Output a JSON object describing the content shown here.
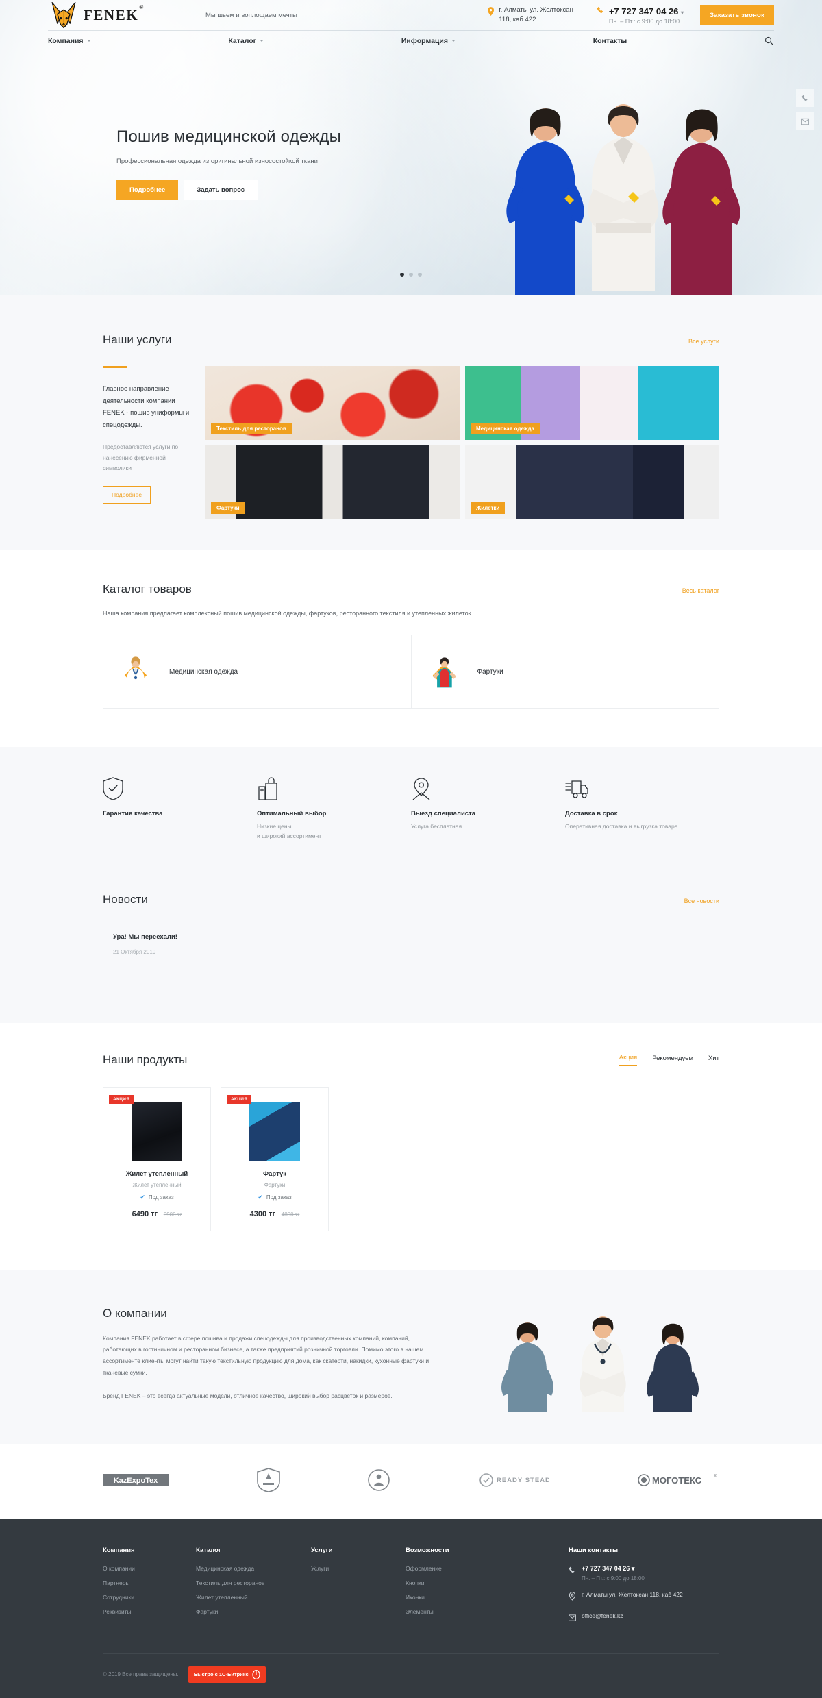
{
  "header": {
    "logo_text": "FENEK",
    "logo_reg": "®",
    "tagline": "Мы шьем и воплощаем мечты",
    "address_line1": "г. Алматы ул. Желтоксан",
    "address_line2": "118, каб 422",
    "phone": "+7 727 347 04 26",
    "phone_hours": "Пн. – Пт.: с 9:00 до 18:00",
    "order_button": "Заказать звонок",
    "nav": [
      {
        "label": "Компания",
        "has_caret": true
      },
      {
        "label": "Каталог",
        "has_caret": true
      },
      {
        "label": "Информация",
        "has_caret": true
      },
      {
        "label": "Контакты",
        "has_caret": false
      }
    ]
  },
  "hero": {
    "title": "Пошив медицинской одежды",
    "subtitle": "Профессиональная одежда из оригинальной износостойкой ткани",
    "btn_primary": "Подробнее",
    "btn_secondary": "Задать вопрос",
    "slides": 3,
    "active_slide": 1
  },
  "services": {
    "title": "Наши услуги",
    "all_link": "Все услуги",
    "lead": "Главное направление деятельности компании FENEK - пошив униформы и спецодежды.",
    "note": "Предоставляются услуги по нанесению фирменной символики",
    "button": "Подробнее",
    "cards": [
      {
        "label": "Текстиль для ресторанов",
        "art": "ph-rest"
      },
      {
        "label": "Медицинская одежда",
        "art": "ph-med"
      },
      {
        "label": "Фартуки",
        "art": "ph-apr"
      },
      {
        "label": "Жилетки",
        "art": "ph-vest"
      }
    ]
  },
  "catalog": {
    "title": "Каталог товаров",
    "all_link": "Весь каталог",
    "description": "Наша компания предлагает комплексный пошив медицинской одежды, фартуков, ресторанного текстиля и утепленных жилеток",
    "items": [
      {
        "name": "Медицинская одежда",
        "icon": "doctor-icon"
      },
      {
        "name": "Фартуки",
        "icon": "apron-woman-icon"
      }
    ]
  },
  "features": [
    {
      "icon": "shield-check-icon",
      "title": "Гарантия качества",
      "sub": ""
    },
    {
      "icon": "price-tag-bag-icon",
      "title": "Оптимальный выбор",
      "sub": "Низкие цены\nи широкий ассортимент"
    },
    {
      "icon": "map-pin-person-icon",
      "title": "Выезд специалиста",
      "sub": "Услуга бесплатная"
    },
    {
      "icon": "delivery-truck-icon",
      "title": "Доставка в срок",
      "sub": "Оперативная доставка и выгрузка товара"
    }
  ],
  "news": {
    "title": "Новости",
    "all_link": "Все новости",
    "items": [
      {
        "title": "Ура! Мы переехали!",
        "date": "21 Октября 2019"
      }
    ]
  },
  "products": {
    "title": "Наши продукты",
    "tabs": [
      {
        "label": "Акция",
        "active": true
      },
      {
        "label": "Рекомендуем",
        "active": false
      },
      {
        "label": "Хит",
        "active": false
      }
    ],
    "items": [
      {
        "badge": "АКЦИЯ",
        "name": "Жилет утепленный",
        "category": "Жилет утепленный",
        "status": "Под заказ",
        "price": "6490 тг",
        "old_price": "6900 тг",
        "art": "ph-vestA"
      },
      {
        "badge": "АКЦИЯ",
        "name": "Фартук",
        "category": "Фартуки",
        "status": "Под заказ",
        "price": "4300 тг",
        "old_price": "4800 тг",
        "art": "ph-aprA"
      }
    ]
  },
  "about": {
    "title": "О компании",
    "p1": "Компания FENEK работает в сфере пошива и продажи спецодежды для производственных компаний, компаний, работающих в гостиничном и ресторанном бизнесе, а также предприятий розничной торговли. Помимо этого в нашем ассортименте клиенты могут найти такую текстильную продукцию для дома, как скатерти, накидки, кухонные фартуки и тканевые сумки.",
    "p2": "Бренд FENEK – это всегда актуальные модели, отличное качество, широкий выбор расцветок и размеров."
  },
  "partners": [
    {
      "name": "KazExpoTex"
    },
    {
      "name": "shield-emblem"
    },
    {
      "name": "circle-person-logo"
    },
    {
      "name": "READY STEADY"
    },
    {
      "name": "МОГОТЕКС"
    }
  ],
  "footer": {
    "columns": [
      {
        "heading": "Компания",
        "links": [
          "О компании",
          "Партнеры",
          "Сотрудники",
          "Реквизиты"
        ]
      },
      {
        "heading": "Каталог",
        "links": [
          "Медицинская одежда",
          "Текстиль для ресторанов",
          "Жилет утепленный",
          "Фартуки"
        ]
      },
      {
        "heading": "Услуги",
        "links": [
          "Услуги"
        ]
      },
      {
        "heading": "Возможности",
        "links": [
          "Оформление",
          "Кнопки",
          "Иконки",
          "Элементы"
        ]
      }
    ],
    "contacts": {
      "heading": "Наши контакты",
      "phone": "+7 727 347 04 26",
      "hours": "Пн. – Пт.: с 9:00 до 18:00",
      "address": "г. Алматы ул. Желтоксан 118, каб 422",
      "email": "office@fenek.kz"
    },
    "copyright": "© 2019 Все права защищены.",
    "bitrix_label": "Быстро с 1С-Битрикс"
  },
  "colors": {
    "accent": "#f0a01e",
    "accent_button": "#f5a623",
    "dark": "#343a40",
    "badge_red": "#e8362a",
    "bitrix_red": "#f03b20"
  }
}
